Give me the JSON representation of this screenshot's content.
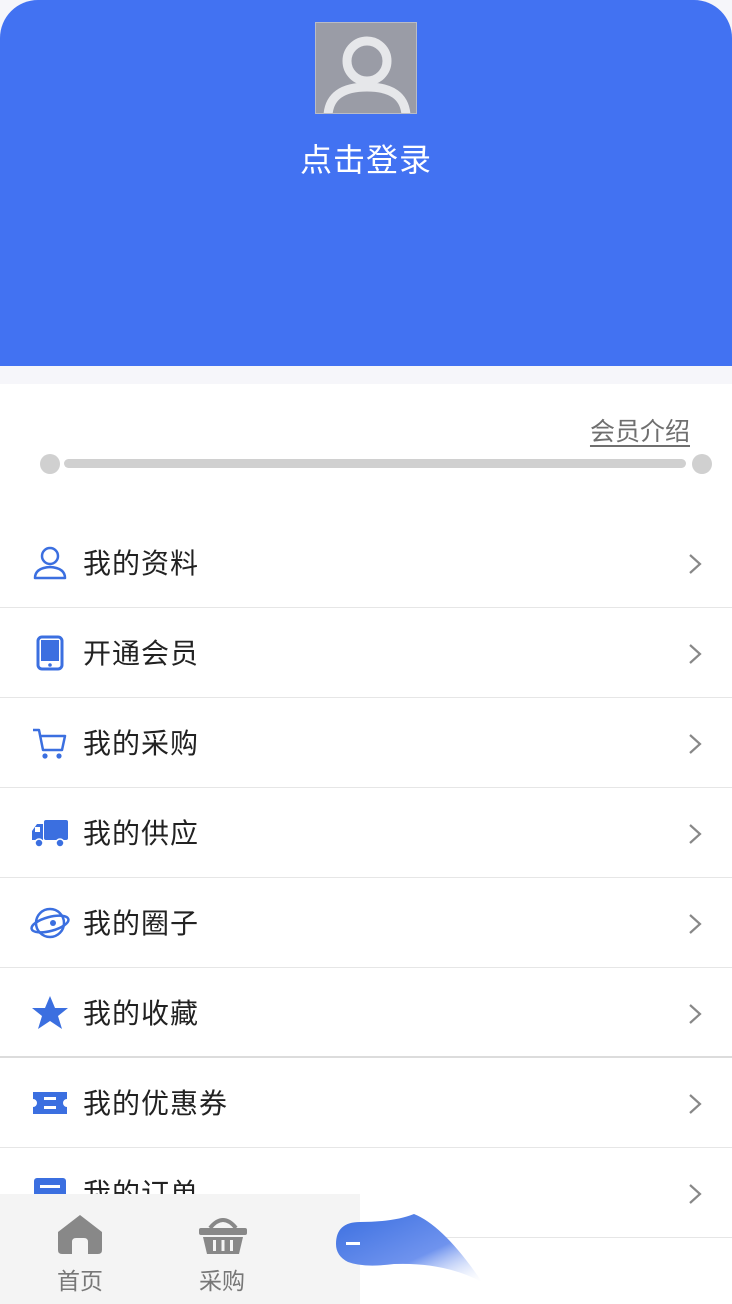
{
  "header": {
    "login_text": "点击登录",
    "background": "#4272f2"
  },
  "member": {
    "intro_link": "会员介绍",
    "progress": 0
  },
  "menu": {
    "items": [
      {
        "label": "我的资料",
        "icon": "person-icon"
      },
      {
        "label": "开通会员",
        "icon": "tablet-icon"
      },
      {
        "label": "我的采购",
        "icon": "cart-icon"
      },
      {
        "label": "我的供应",
        "icon": "truck-icon"
      },
      {
        "label": "我的圈子",
        "icon": "planet-icon"
      },
      {
        "label": "我的收藏",
        "icon": "star-icon"
      },
      {
        "label": "我的优惠券",
        "icon": "coupon-icon"
      },
      {
        "label": "我的订单",
        "icon": "order-icon"
      }
    ]
  },
  "tabbar": {
    "items": [
      {
        "label": "首页",
        "icon": "home-icon"
      },
      {
        "label": "采购",
        "icon": "basket-icon"
      }
    ]
  },
  "colors": {
    "accent": "#4272f2",
    "icon_blue": "#3b6fe0",
    "divider": "#e6e6e6"
  }
}
